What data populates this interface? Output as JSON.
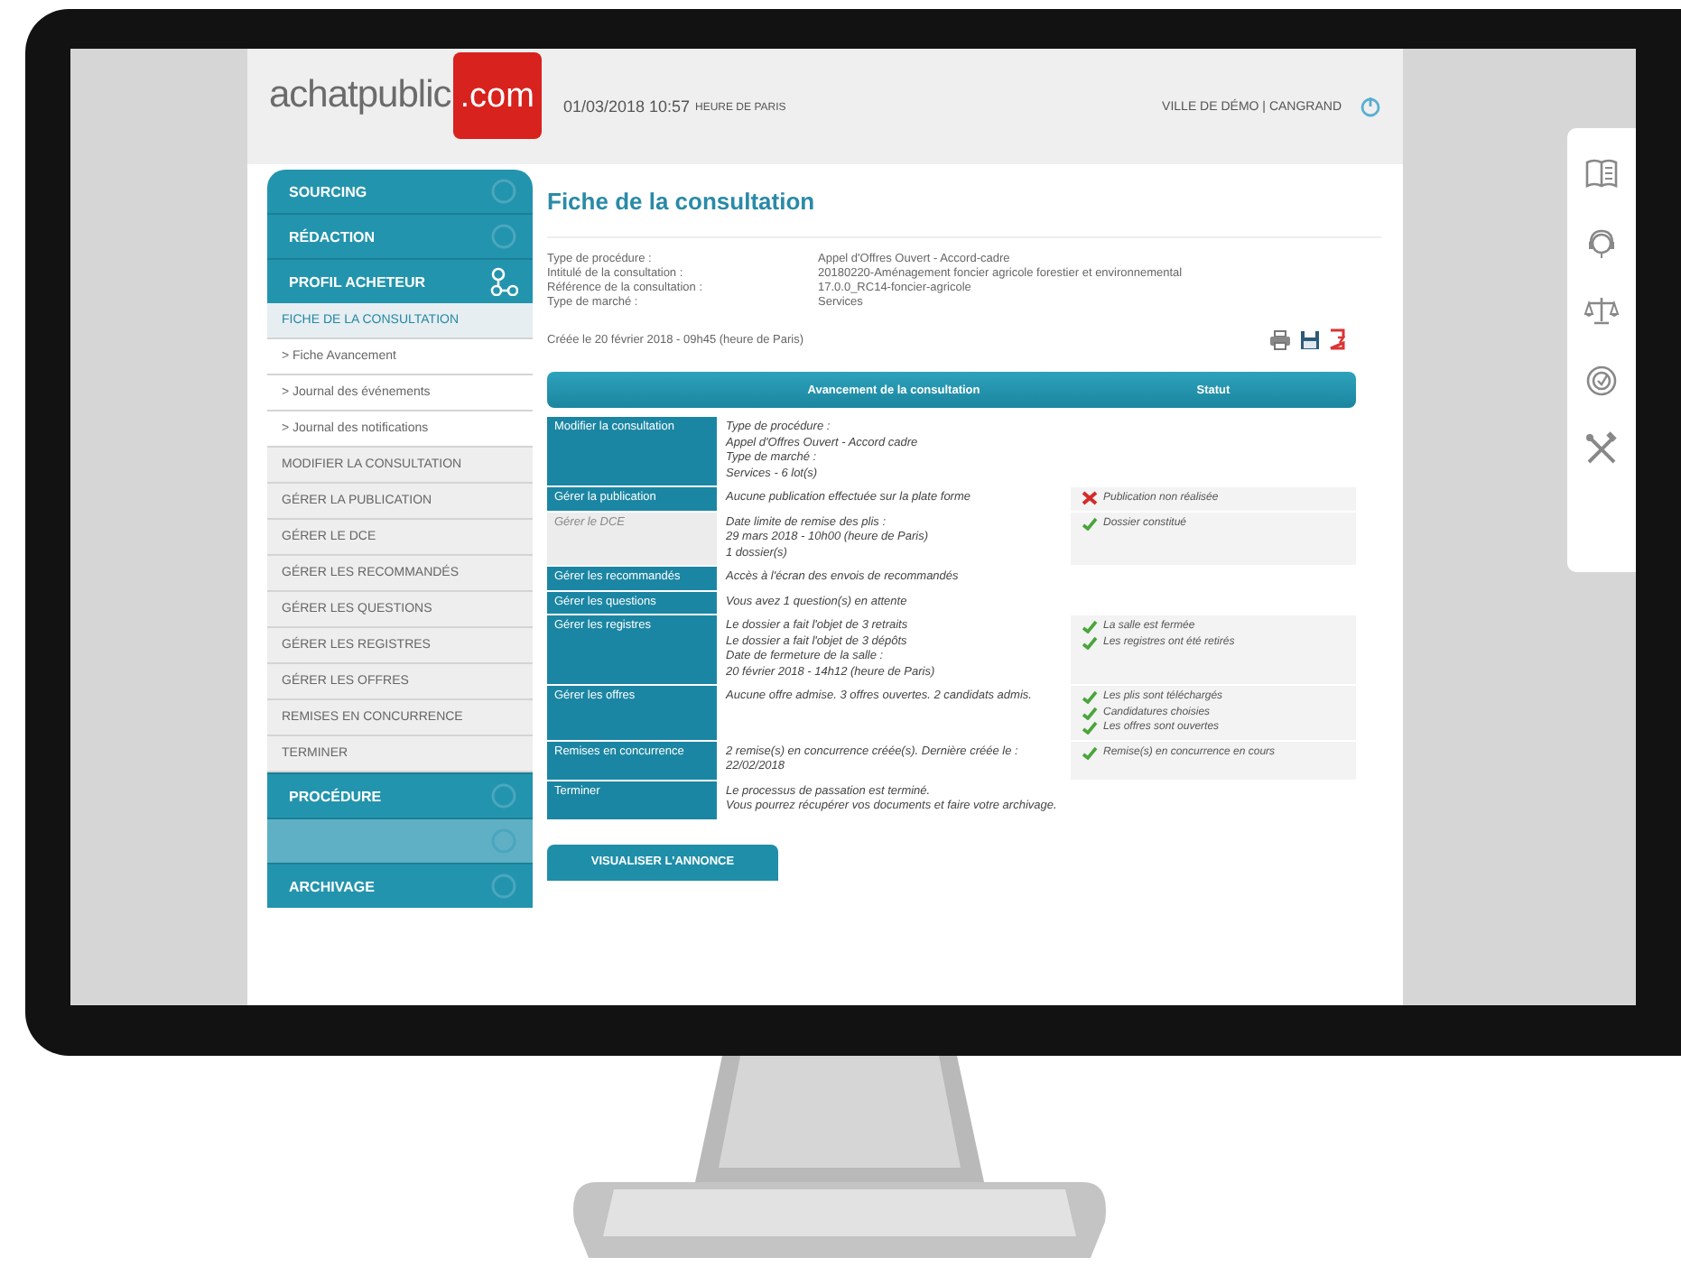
{
  "header": {
    "logo_text": "achatpublic",
    "logo_suffix": ".com",
    "datetime": "01/03/2018 10:57",
    "timezone": "HEURE DE PARIS",
    "user": "VILLE DE DÉMO | CANGRAND"
  },
  "sidebar": {
    "items": [
      {
        "kind": "section",
        "label": "SOURCING",
        "expanded": false,
        "disabled": false
      },
      {
        "kind": "section",
        "label": "RÉDACTION",
        "expanded": false,
        "disabled": false
      },
      {
        "kind": "section",
        "label": "PROFIL ACHETEUR",
        "expanded": true,
        "disabled": false
      },
      {
        "kind": "item",
        "label": "FICHE DE LA CONSULTATION",
        "selected": true
      },
      {
        "kind": "subitem",
        "label": "> Fiche Avancement",
        "selected": false
      },
      {
        "kind": "subitem",
        "label": "> Journal des événements",
        "selected": false
      },
      {
        "kind": "subitem",
        "label": "> Journal des notifications",
        "selected": false
      },
      {
        "kind": "item",
        "label": "MODIFIER LA CONSULTATION",
        "selected": false
      },
      {
        "kind": "item",
        "label": "GÉRER LA PUBLICATION",
        "selected": false
      },
      {
        "kind": "item",
        "label": "GÉRER LE DCE",
        "selected": false
      },
      {
        "kind": "item",
        "label": "GÉRER LES RECOMMANDÉS",
        "selected": false
      },
      {
        "kind": "item",
        "label": "GÉRER LES QUESTIONS",
        "selected": false
      },
      {
        "kind": "item",
        "label": "GÉRER LES REGISTRES",
        "selected": false
      },
      {
        "kind": "item",
        "label": "GÉRER LES OFFRES",
        "selected": false
      },
      {
        "kind": "item",
        "label": "REMISES EN CONCURRENCE",
        "selected": false
      },
      {
        "kind": "item",
        "label": "TERMINER",
        "selected": false
      },
      {
        "kind": "section",
        "label": "PROCÉDURE",
        "expanded": false,
        "disabled": false
      },
      {
        "kind": "section",
        "expanded": false,
        "disabled": true
      },
      {
        "kind": "section",
        "label": "ARCHIVAGE",
        "expanded": false,
        "disabled": false
      }
    ]
  },
  "page": {
    "title": "Fiche de la consultation",
    "details": [
      {
        "label": "Type de procédure :",
        "value": "Appel d'Offres Ouvert - Accord-cadre"
      },
      {
        "label": "Intitulé de la consultation :",
        "value": "20180220-Aménagement foncier agricole forestier et environnemental"
      },
      {
        "label": "Référence de la consultation :",
        "value": "17.0.0_RC14-foncier-agricole"
      },
      {
        "label": "Type de marché :",
        "value": "Services"
      }
    ],
    "created": "Créée le 20 février 2018 - 09h45 (heure de Paris)"
  },
  "table": {
    "columns": [
      "Avancement de la consultation",
      "Statut"
    ],
    "rows": [
      {
        "action": "Modifier la consultation",
        "disabled": false,
        "lines": [
          "Type de procédure :",
          "Appel d'Offres Ouvert  - Accord cadre",
          "Type de marché :",
          "Services - 6 lot(s)"
        ],
        "status": []
      },
      {
        "action": "Gérer la publication",
        "disabled": false,
        "lines": [
          "Aucune publication effectuée sur la plate forme"
        ],
        "status": [
          {
            "kind": "error",
            "text": "Publication non réalisée"
          }
        ]
      },
      {
        "action": "Gérer le DCE",
        "disabled": true,
        "lines": [
          "Date limite de remise des plis :",
          "29 mars 2018 - 10h00 (heure de Paris)",
          "1 dossier(s)"
        ],
        "status": [
          {
            "kind": "ok",
            "text": "Dossier constitué"
          }
        ]
      },
      {
        "action": "Gérer les recommandés",
        "disabled": false,
        "lines": [
          "Accès à l'écran des envois de recommandés"
        ],
        "status": []
      },
      {
        "action": "Gérer les questions",
        "disabled": false,
        "lines": [
          "Vous avez 1 question(s) en attente"
        ],
        "status": []
      },
      {
        "action": "Gérer les registres",
        "disabled": false,
        "lines": [
          "Le dossier a fait l'objet de 3 retraits",
          "Le dossier a fait l'objet de 3 dépôts",
          "Date de fermeture de la salle :",
          "20 février 2018 - 14h12 (heure de Paris)"
        ],
        "status": [
          {
            "kind": "ok",
            "text": "La salle est fermée"
          },
          {
            "kind": "ok",
            "text": "Les registres ont été retirés"
          }
        ]
      },
      {
        "action": "Gérer les offres",
        "disabled": false,
        "lines": [
          "Aucune offre admise. 3 offres ouvertes.  2 candidats admis."
        ],
        "status": [
          {
            "kind": "ok",
            "text": "Les plis sont téléchargés"
          },
          {
            "kind": "ok",
            "text": "Candidatures choisies"
          },
          {
            "kind": "ok",
            "text": "Les offres sont ouvertes"
          }
        ]
      },
      {
        "action": "Remises en concurrence",
        "disabled": false,
        "lines": [
          "2 remise(s) en concurrence créée(s). Dernière créée le :",
          "22/02/2018"
        ],
        "status": [
          {
            "kind": "ok",
            "text": "Remise(s) en concurrence en cours"
          }
        ]
      },
      {
        "action": "Terminer",
        "disabled": false,
        "lines": [
          "Le processus de passation est terminé.",
          "Vous pourrez récupérer vos documents et faire votre archivage."
        ],
        "status": []
      }
    ]
  },
  "button": "VISUALISER L'ANNONCE"
}
